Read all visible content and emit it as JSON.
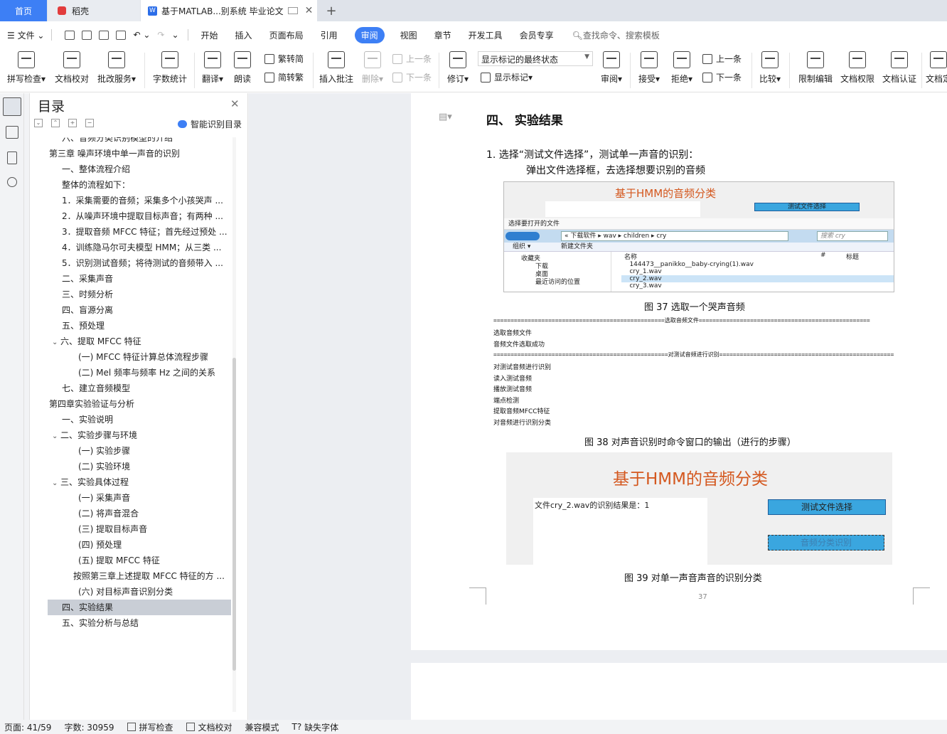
{
  "tabs": {
    "home": "首页",
    "daoke": "稻壳",
    "doc": "基于MATLAB...别系统 毕业论文"
  },
  "menu": {
    "file": "文件",
    "items": [
      "开始",
      "插入",
      "页面布局",
      "引用"
    ],
    "active": "审阅",
    "items2": [
      "视图",
      "章节",
      "开发工具",
      "会员专享"
    ],
    "search": "查找命令、搜索模板"
  },
  "ribbon": {
    "spellcheck": "拼写检查",
    "doc_proof": "文档校对",
    "batch_service": "批改服务",
    "word_count": "字数统计",
    "translate": "翻译",
    "read_aloud": "朗读",
    "trad_simp": "繁转简",
    "simp_trad": "简转繁",
    "insert_comment": "插入批注",
    "delete": "删除",
    "prev": "上一条",
    "next": "下一条",
    "revise": "修订",
    "markup_state": "显示标记的最终状态",
    "show_markup": "显示标记",
    "review": "审阅",
    "accept": "接受",
    "reject": "拒绝",
    "prev2": "上一条",
    "next2": "下一条",
    "compare": "比较",
    "restrict_edit": "限制编辑",
    "doc_rights": "文档权限",
    "doc_auth": "文档认证",
    "doc_cut": "文档定"
  },
  "toc": {
    "title": "目录",
    "smart": "智能识别目录",
    "items": [
      {
        "text": "六、音频分类识别模型的介绍",
        "indent": 1,
        "arrow": ""
      },
      {
        "text": "第三章 噪声环境中单一声音的识别",
        "indent": 0,
        "arrow": "v"
      },
      {
        "text": "一、整体流程介绍",
        "indent": 1,
        "arrow": ""
      },
      {
        "text": "整体的流程如下：",
        "indent": 1,
        "arrow": ""
      },
      {
        "text": "1．采集需要的音频；采集多个小孩哭声 ...",
        "indent": 1,
        "arrow": ""
      },
      {
        "text": "2．从噪声环境中提取目标声音；有两种 ...",
        "indent": 1,
        "arrow": ""
      },
      {
        "text": "3．提取音频 MFCC 特征；首先经过预处 ...",
        "indent": 1,
        "arrow": ""
      },
      {
        "text": "4．训练隐马尔可夫模型 HMM；从三类 ...",
        "indent": 1,
        "arrow": ""
      },
      {
        "text": "5．识别测试音频；将待测试的音频带入 ...",
        "indent": 1,
        "arrow": ""
      },
      {
        "text": "二、采集声音",
        "indent": 1,
        "arrow": ""
      },
      {
        "text": "三、时频分析",
        "indent": 1,
        "arrow": ""
      },
      {
        "text": "四、盲源分离",
        "indent": 1,
        "arrow": ""
      },
      {
        "text": "五、预处理",
        "indent": 1,
        "arrow": ""
      },
      {
        "text": "六、提取 MFCC 特征",
        "indent": 1,
        "arrow": "v"
      },
      {
        "text": "(一) MFCC 特征计算总体流程步骤",
        "indent": 2,
        "arrow": ""
      },
      {
        "text": "(二) Mel 频率与频率 Hz 之间的关系",
        "indent": 2,
        "arrow": ""
      },
      {
        "text": "七、建立音频模型",
        "indent": 1,
        "arrow": ""
      },
      {
        "text": "第四章实验验证与分析",
        "indent": 0,
        "arrow": "v"
      },
      {
        "text": "一、实验说明",
        "indent": 1,
        "arrow": ""
      },
      {
        "text": "二、实验步骤与环境",
        "indent": 1,
        "arrow": "v"
      },
      {
        "text": "(一) 实验步骤",
        "indent": 2,
        "arrow": ""
      },
      {
        "text": "(二) 实验环境",
        "indent": 2,
        "arrow": ""
      },
      {
        "text": "三、实验具体过程",
        "indent": 1,
        "arrow": "v"
      },
      {
        "text": "(一) 采集声音",
        "indent": 2,
        "arrow": ""
      },
      {
        "text": "(二) 将声音混合",
        "indent": 2,
        "arrow": ""
      },
      {
        "text": "(三) 提取目标声音",
        "indent": 2,
        "arrow": ""
      },
      {
        "text": "(四) 预处理",
        "indent": 2,
        "arrow": ""
      },
      {
        "text": "(五) 提取 MFCC 特征",
        "indent": 2,
        "arrow": ""
      },
      {
        "text": "按照第三章上述提取 MFCC 特征的方 ...",
        "indent": 3,
        "arrow": ""
      },
      {
        "text": "(六) 对目标声音识别分类",
        "indent": 2,
        "arrow": ""
      },
      {
        "text": "四、实验结果",
        "indent": 1,
        "arrow": "",
        "selected": true
      },
      {
        "text": "五、实验分析与总结",
        "indent": 1,
        "arrow": ""
      }
    ]
  },
  "doc": {
    "heading": "四、 实验结果",
    "step1": "1.  选择“测试文件选择”，测试单一声音的识别：",
    "step1_sub": "弹出文件选择框，去选择想要识别的音频",
    "fig37": {
      "title": "基于HMM的音频分类",
      "button": "测试文件选择",
      "dialog_title": "选择要打开的文件",
      "path": "«  下载软件  ▸  wav  ▸  children  ▸  cry",
      "search": "搜索 cry",
      "organize": "组织 ▾",
      "new_folder": "新建文件夹",
      "fav": "收藏夹",
      "downloads": "下载",
      "desktop": "桌面",
      "recent": "最近访问的位置",
      "col_name": "名称",
      "col_num": "#",
      "col_title": "标题",
      "files": [
        "144473__panikko__baby-crying(1).wav",
        "cry_1.wav",
        "cry_2.wav",
        "cry_3.wav"
      ]
    },
    "cap37": "图 37 选取一个哭声音频",
    "console": {
      "sep1": "==================================================选取音频文件==================================================",
      "l1": "选取音频文件",
      "l2": "音频文件选取成功",
      "sep2": "===================================================对测试音频进行识别===================================================",
      "l3": "对测试音频进行识别",
      "l4": "读入测试音频",
      "l5": "播放测试音频",
      "l6": "端点检测",
      "l7": "提取音频MFCC特征",
      "l8": "对音频进行识别分类"
    },
    "cap38": "图 38 对声音识别时命令窗口的输出（进行的步骤）",
    "fig39": {
      "title": "基于HMM的音频分类",
      "result": "文件cry_2.wav的识别结果是：1",
      "btn1": "测试文件选择",
      "btn2": "音频分类识别"
    },
    "cap39": "图 39 对单一声音声音的识别分类",
    "page_number": "37"
  },
  "status": {
    "page": "页面: 41/59",
    "words": "字数: 30959",
    "spell": "拼写检查",
    "proof": "文档校对",
    "compat": "兼容模式",
    "missing_font": "缺失字体"
  }
}
